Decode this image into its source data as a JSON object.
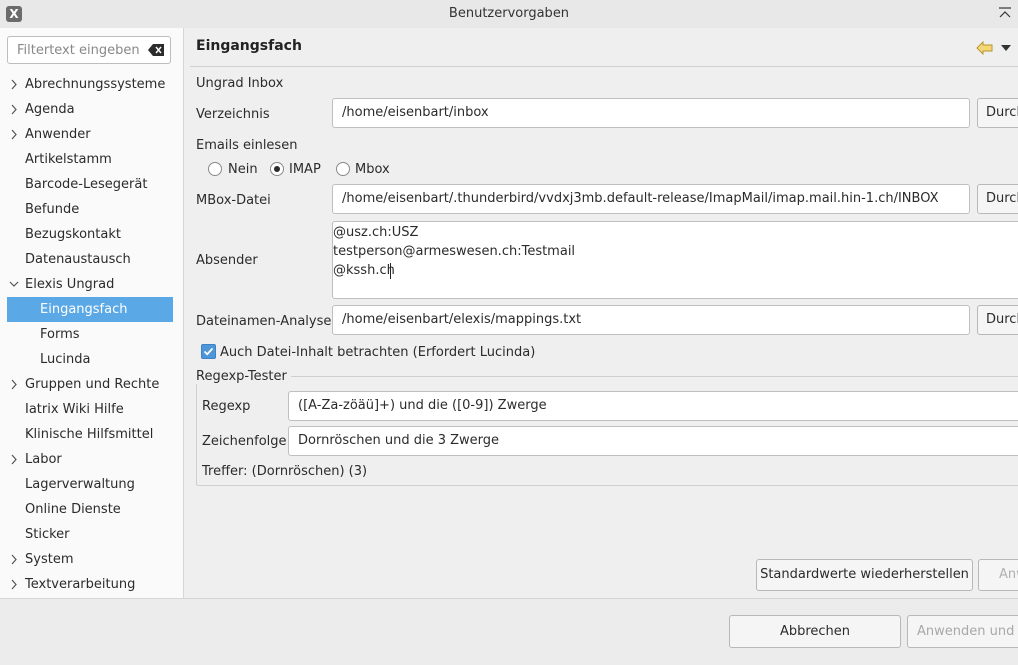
{
  "window": {
    "title": "Benutzervorgaben",
    "app_icon": "X"
  },
  "sidebar": {
    "filter_placeholder": "Filtertext eingeben",
    "items": [
      {
        "label": "Abrechnungssysteme",
        "expandable": true
      },
      {
        "label": "Agenda",
        "expandable": true
      },
      {
        "label": "Anwender",
        "expandable": true
      },
      {
        "label": "Artikelstamm",
        "expandable": false
      },
      {
        "label": "Barcode-Lesegerät",
        "expandable": false
      },
      {
        "label": "Befunde",
        "expandable": false
      },
      {
        "label": "Bezugskontakt",
        "expandable": false
      },
      {
        "label": "Datenaustausch",
        "expandable": false
      },
      {
        "label": "Elexis Ungrad",
        "expandable": true,
        "expanded": true
      },
      {
        "label": "Eingangsfach",
        "child": true,
        "selected": true
      },
      {
        "label": "Forms",
        "child": true
      },
      {
        "label": "Lucinda",
        "child": true
      },
      {
        "label": "Gruppen und Rechte",
        "expandable": true
      },
      {
        "label": "Iatrix Wiki Hilfe",
        "expandable": false
      },
      {
        "label": "Klinische Hilfsmittel",
        "expandable": false
      },
      {
        "label": "Labor",
        "expandable": true
      },
      {
        "label": "Lagerverwaltung",
        "expandable": false
      },
      {
        "label": "Online Dienste",
        "expandable": false
      },
      {
        "label": "Sticker",
        "expandable": false
      },
      {
        "label": "System",
        "expandable": true
      },
      {
        "label": "Textverarbeitung",
        "expandable": true
      }
    ]
  },
  "page": {
    "title": "Eingangsfach",
    "section_label": "Ungrad Inbox",
    "verzeichnis_label": "Verzeichnis",
    "verzeichnis_value": "/home/eisenbart/inbox",
    "browse_label": "Durch",
    "emails_label": "Emails einlesen",
    "radio_nein": "Nein",
    "radio_imap": "IMAP",
    "radio_mbox": "Mbox",
    "mbox_label": "MBox-Datei",
    "mbox_value": "/home/eisenbart/.thunderbird/vvdxj3mb.default-release/ImapMail/imap.mail.hin-1.ch/INBOX",
    "absender_label": "Absender",
    "absender_lines": [
      "@usz.ch:USZ",
      "testperson@armeswesen.ch:Testmail",
      "@kssh.ch"
    ],
    "dateinamen_label": "Dateinamen-Analyse",
    "dateinamen_value": "/home/eisenbart/elexis/mappings.txt",
    "checkbox_label": "Auch Datei-Inhalt betrachten (Erfordert Lucinda)",
    "regexp_group_title": "Regexp-Tester",
    "regexp_label": "Regexp",
    "regexp_value": "([A-Za-zöäü]+) und die ([0-9]) Zwerge",
    "zeichenfolge_label": "Zeichenfolge",
    "zeichenfolge_value": "Dornröschen und die 3 Zwerge",
    "treffer_text": "Treffer: (Dornröschen) (3)",
    "restore_defaults": "Standardwerte wiederherstellen",
    "apply_partial": "Anw"
  },
  "footer": {
    "cancel": "Abbrechen",
    "apply_close": "Anwenden und S"
  }
}
